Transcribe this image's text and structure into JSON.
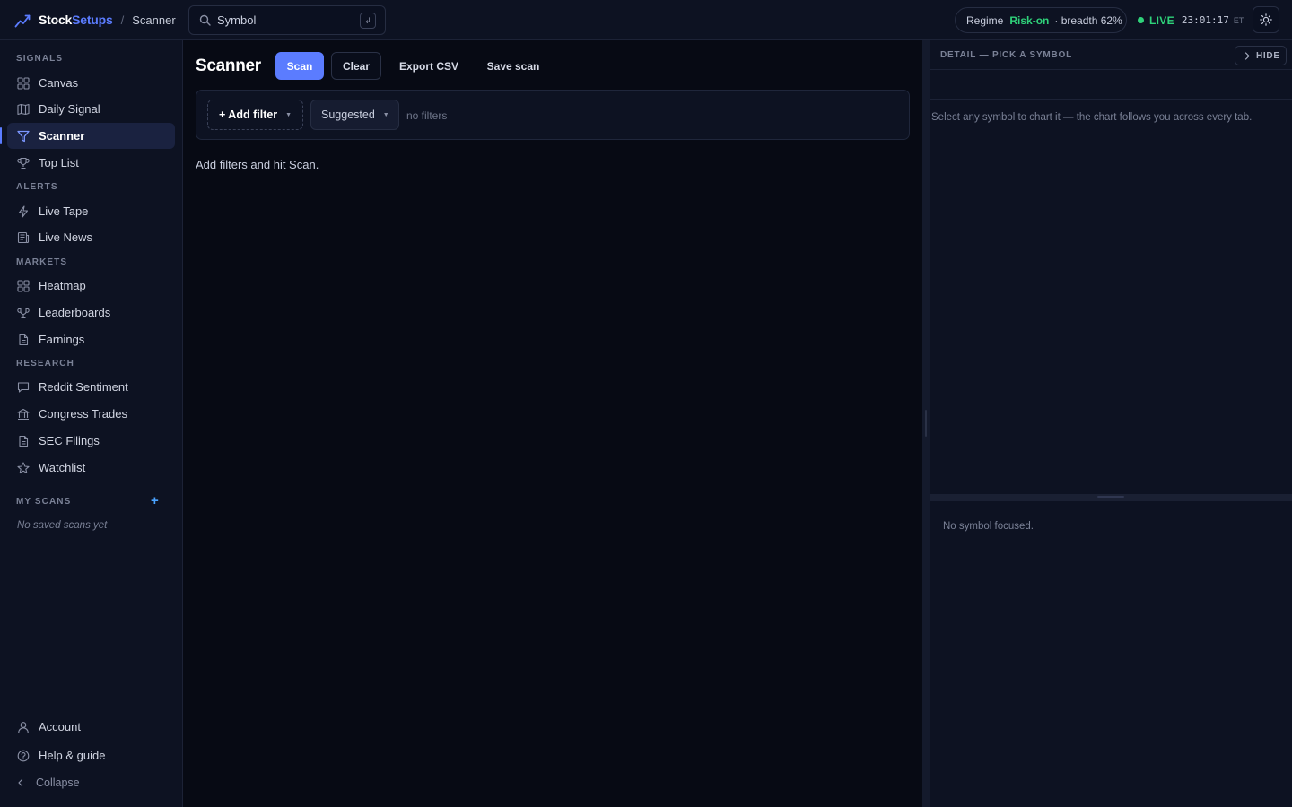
{
  "brand": {
    "name_part1": "Stock",
    "name_part2": "Setups",
    "logo_icon": "trend-line-icon"
  },
  "breadcrumb": {
    "separator": "/",
    "current": "Scanner"
  },
  "search": {
    "value": "Symbol",
    "shortcut": "↲"
  },
  "regime": {
    "label": "Regime",
    "value": "Risk-on",
    "breadth": "· breadth 62%"
  },
  "live": {
    "label": "LIVE",
    "time": "23:01:17",
    "tz": "ET"
  },
  "sidebar": {
    "sections": {
      "signals": "SIGNALS",
      "alerts": "ALERTS",
      "markets": "MARKETS",
      "research": "RESEARCH",
      "my_scans": "MY SCANS"
    },
    "items": {
      "canvas": "Canvas",
      "daily_signal": "Daily Signal",
      "scanner": "Scanner",
      "top_list": "Top List",
      "live_tape": "Live Tape",
      "live_news": "Live News",
      "heatmap": "Heatmap",
      "leaderboards": "Leaderboards",
      "earnings": "Earnings",
      "reddit_sentiment": "Reddit Sentiment",
      "congress_trades": "Congress Trades",
      "sec_filings": "SEC Filings",
      "watchlist": "Watchlist"
    },
    "my_scans_add": "+",
    "no_scans": "No saved scans yet",
    "footer": {
      "account": "Account",
      "help": "Help & guide",
      "collapse": "Collapse"
    }
  },
  "main": {
    "title": "Scanner",
    "buttons": {
      "scan": "Scan",
      "clear": "Clear",
      "export": "Export CSV",
      "save": "Save scan"
    },
    "filter_bar": {
      "add_filter": "+ Add filter",
      "suggested": "Suggested",
      "no_filters": "no filters"
    },
    "hint": "Add filters and hit Scan."
  },
  "detail": {
    "title": "DETAIL — PICK A SYMBOL",
    "hide": "HIDE",
    "message": "Select any symbol to chart it — the chart follows you across every tab.",
    "no_focus": "No symbol focused."
  },
  "colors": {
    "accent": "#5b7cff",
    "positive": "#2fd27a",
    "background": "#070a14",
    "panel": "#0d1222"
  }
}
